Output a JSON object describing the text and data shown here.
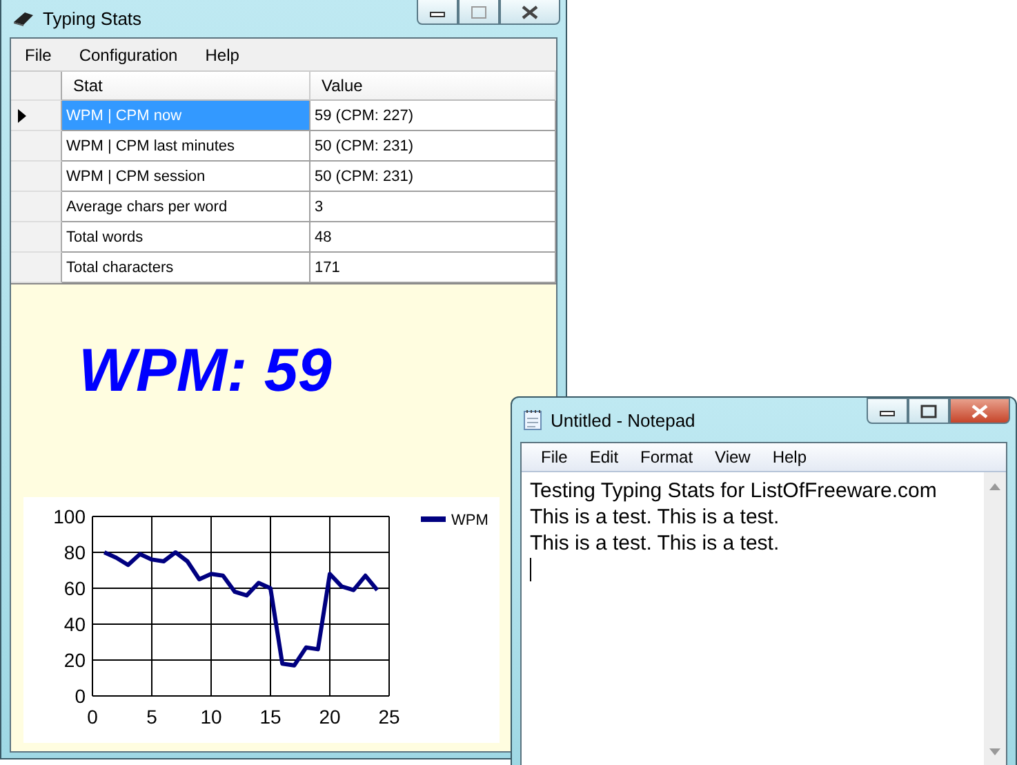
{
  "stats_window": {
    "title": "Typing Stats",
    "menu": [
      "File",
      "Configuration",
      "Help"
    ],
    "table": {
      "columns": [
        "Stat",
        "Value"
      ],
      "rows": [
        {
          "stat": "WPM | CPM now",
          "value": "59 (CPM: 227)",
          "selected": true
        },
        {
          "stat": "WPM | CPM last minutes",
          "value": "50 (CPM: 231)",
          "selected": false
        },
        {
          "stat": "WPM | CPM session",
          "value": "50 (CPM: 231)",
          "selected": false
        },
        {
          "stat": "Average chars per word",
          "value": "3",
          "selected": false
        },
        {
          "stat": "Total words",
          "value": "48",
          "selected": false
        },
        {
          "stat": "Total characters",
          "value": "171",
          "selected": false
        }
      ]
    },
    "wpm_display": "WPM: 59",
    "chart": {
      "chart_data": {
        "type": "line",
        "x": [
          1,
          2,
          3,
          4,
          5,
          6,
          7,
          8,
          9,
          10,
          11,
          12,
          13,
          14,
          15,
          16,
          17,
          18,
          19,
          20,
          21,
          22,
          23,
          24
        ],
        "series": [
          {
            "name": "WPM",
            "color": "#000080",
            "values": [
              80,
              77,
              73,
              79,
              76,
              75,
              80,
              75,
              65,
              68,
              67,
              58,
              56,
              63,
              60,
              18,
              17,
              27,
              26,
              68,
              61,
              59,
              67,
              59
            ]
          }
        ],
        "grid": true,
        "xlim": [
          0,
          25
        ],
        "ylim": [
          0,
          100
        ],
        "xticks": [
          0,
          5,
          10,
          15,
          20,
          25
        ],
        "yticks": [
          0,
          20,
          40,
          60,
          80,
          100
        ]
      }
    }
  },
  "notepad_window": {
    "title": "Untitled - Notepad",
    "menu": [
      "File",
      "Edit",
      "Format",
      "View",
      "Help"
    ],
    "lines": [
      "Testing Typing Stats for ListOfFreeware.com",
      "This is a test. This is a test.",
      "This is a test. This is a test."
    ]
  }
}
